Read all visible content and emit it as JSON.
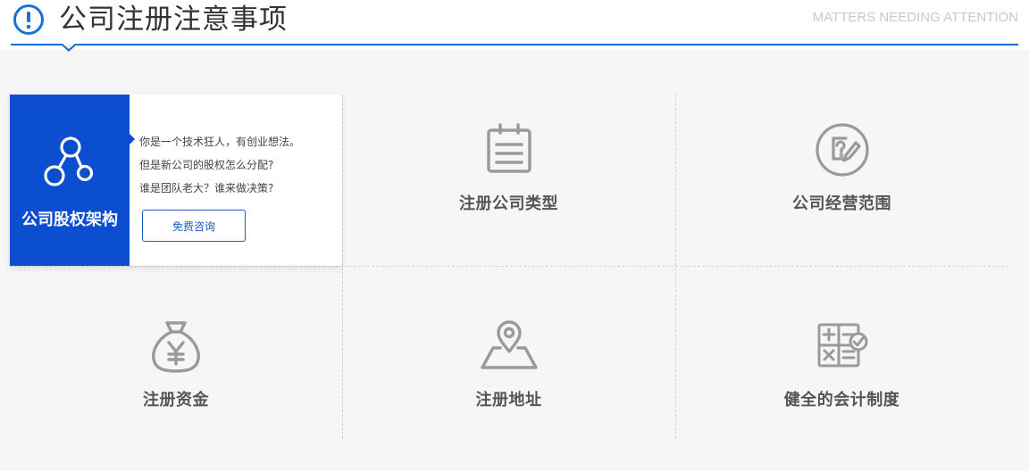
{
  "header": {
    "title": "公司注册注意事项",
    "subtitle": "MATTERS NEEDING ATTENTION",
    "accent_color": "#1c6fd6"
  },
  "feature": {
    "title": "公司股权架构",
    "icon": "share-nodes-icon",
    "lines": [
      "你是一个技术狂人，有创业想法。",
      "但是新公司的股权怎么分配?",
      "谁是团队老大？谁来做决策?"
    ],
    "button_label": "免费咨询",
    "bg_color": "#0b4fd0"
  },
  "items": [
    {
      "label": "注册公司类型",
      "icon": "calendar-list-icon"
    },
    {
      "label": "公司经营范围",
      "icon": "question-edit-icon"
    },
    {
      "label": "注册资金",
      "icon": "money-bag-icon"
    },
    {
      "label": "注册地址",
      "icon": "map-pin-icon"
    },
    {
      "label": "健全的会计制度",
      "icon": "calculator-check-icon"
    }
  ]
}
